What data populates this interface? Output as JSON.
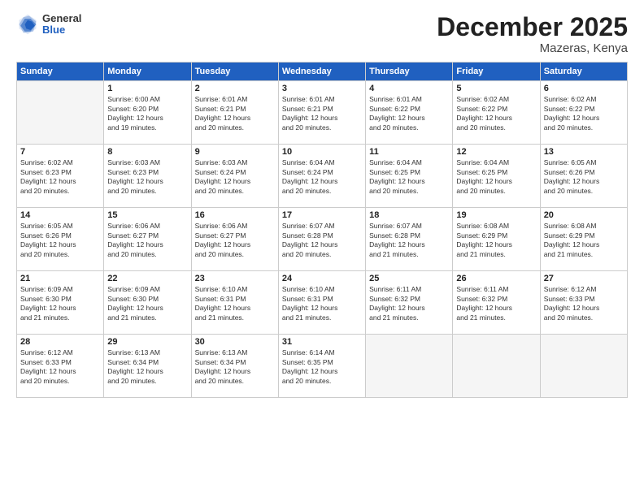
{
  "logo": {
    "general": "General",
    "blue": "Blue"
  },
  "title": "December 2025",
  "location": "Mazeras, Kenya",
  "days_header": [
    "Sunday",
    "Monday",
    "Tuesday",
    "Wednesday",
    "Thursday",
    "Friday",
    "Saturday"
  ],
  "weeks": [
    [
      {
        "day": "",
        "info": ""
      },
      {
        "day": "1",
        "info": "Sunrise: 6:00 AM\nSunset: 6:20 PM\nDaylight: 12 hours\nand 19 minutes."
      },
      {
        "day": "2",
        "info": "Sunrise: 6:01 AM\nSunset: 6:21 PM\nDaylight: 12 hours\nand 20 minutes."
      },
      {
        "day": "3",
        "info": "Sunrise: 6:01 AM\nSunset: 6:21 PM\nDaylight: 12 hours\nand 20 minutes."
      },
      {
        "day": "4",
        "info": "Sunrise: 6:01 AM\nSunset: 6:22 PM\nDaylight: 12 hours\nand 20 minutes."
      },
      {
        "day": "5",
        "info": "Sunrise: 6:02 AM\nSunset: 6:22 PM\nDaylight: 12 hours\nand 20 minutes."
      },
      {
        "day": "6",
        "info": "Sunrise: 6:02 AM\nSunset: 6:22 PM\nDaylight: 12 hours\nand 20 minutes."
      }
    ],
    [
      {
        "day": "7",
        "info": "Sunrise: 6:02 AM\nSunset: 6:23 PM\nDaylight: 12 hours\nand 20 minutes."
      },
      {
        "day": "8",
        "info": "Sunrise: 6:03 AM\nSunset: 6:23 PM\nDaylight: 12 hours\nand 20 minutes."
      },
      {
        "day": "9",
        "info": "Sunrise: 6:03 AM\nSunset: 6:24 PM\nDaylight: 12 hours\nand 20 minutes."
      },
      {
        "day": "10",
        "info": "Sunrise: 6:04 AM\nSunset: 6:24 PM\nDaylight: 12 hours\nand 20 minutes."
      },
      {
        "day": "11",
        "info": "Sunrise: 6:04 AM\nSunset: 6:25 PM\nDaylight: 12 hours\nand 20 minutes."
      },
      {
        "day": "12",
        "info": "Sunrise: 6:04 AM\nSunset: 6:25 PM\nDaylight: 12 hours\nand 20 minutes."
      },
      {
        "day": "13",
        "info": "Sunrise: 6:05 AM\nSunset: 6:26 PM\nDaylight: 12 hours\nand 20 minutes."
      }
    ],
    [
      {
        "day": "14",
        "info": "Sunrise: 6:05 AM\nSunset: 6:26 PM\nDaylight: 12 hours\nand 20 minutes."
      },
      {
        "day": "15",
        "info": "Sunrise: 6:06 AM\nSunset: 6:27 PM\nDaylight: 12 hours\nand 20 minutes."
      },
      {
        "day": "16",
        "info": "Sunrise: 6:06 AM\nSunset: 6:27 PM\nDaylight: 12 hours\nand 20 minutes."
      },
      {
        "day": "17",
        "info": "Sunrise: 6:07 AM\nSunset: 6:28 PM\nDaylight: 12 hours\nand 20 minutes."
      },
      {
        "day": "18",
        "info": "Sunrise: 6:07 AM\nSunset: 6:28 PM\nDaylight: 12 hours\nand 21 minutes."
      },
      {
        "day": "19",
        "info": "Sunrise: 6:08 AM\nSunset: 6:29 PM\nDaylight: 12 hours\nand 21 minutes."
      },
      {
        "day": "20",
        "info": "Sunrise: 6:08 AM\nSunset: 6:29 PM\nDaylight: 12 hours\nand 21 minutes."
      }
    ],
    [
      {
        "day": "21",
        "info": "Sunrise: 6:09 AM\nSunset: 6:30 PM\nDaylight: 12 hours\nand 21 minutes."
      },
      {
        "day": "22",
        "info": "Sunrise: 6:09 AM\nSunset: 6:30 PM\nDaylight: 12 hours\nand 21 minutes."
      },
      {
        "day": "23",
        "info": "Sunrise: 6:10 AM\nSunset: 6:31 PM\nDaylight: 12 hours\nand 21 minutes."
      },
      {
        "day": "24",
        "info": "Sunrise: 6:10 AM\nSunset: 6:31 PM\nDaylight: 12 hours\nand 21 minutes."
      },
      {
        "day": "25",
        "info": "Sunrise: 6:11 AM\nSunset: 6:32 PM\nDaylight: 12 hours\nand 21 minutes."
      },
      {
        "day": "26",
        "info": "Sunrise: 6:11 AM\nSunset: 6:32 PM\nDaylight: 12 hours\nand 21 minutes."
      },
      {
        "day": "27",
        "info": "Sunrise: 6:12 AM\nSunset: 6:33 PM\nDaylight: 12 hours\nand 20 minutes."
      }
    ],
    [
      {
        "day": "28",
        "info": "Sunrise: 6:12 AM\nSunset: 6:33 PM\nDaylight: 12 hours\nand 20 minutes."
      },
      {
        "day": "29",
        "info": "Sunrise: 6:13 AM\nSunset: 6:34 PM\nDaylight: 12 hours\nand 20 minutes."
      },
      {
        "day": "30",
        "info": "Sunrise: 6:13 AM\nSunset: 6:34 PM\nDaylight: 12 hours\nand 20 minutes."
      },
      {
        "day": "31",
        "info": "Sunrise: 6:14 AM\nSunset: 6:35 PM\nDaylight: 12 hours\nand 20 minutes."
      },
      {
        "day": "",
        "info": ""
      },
      {
        "day": "",
        "info": ""
      },
      {
        "day": "",
        "info": ""
      }
    ]
  ]
}
